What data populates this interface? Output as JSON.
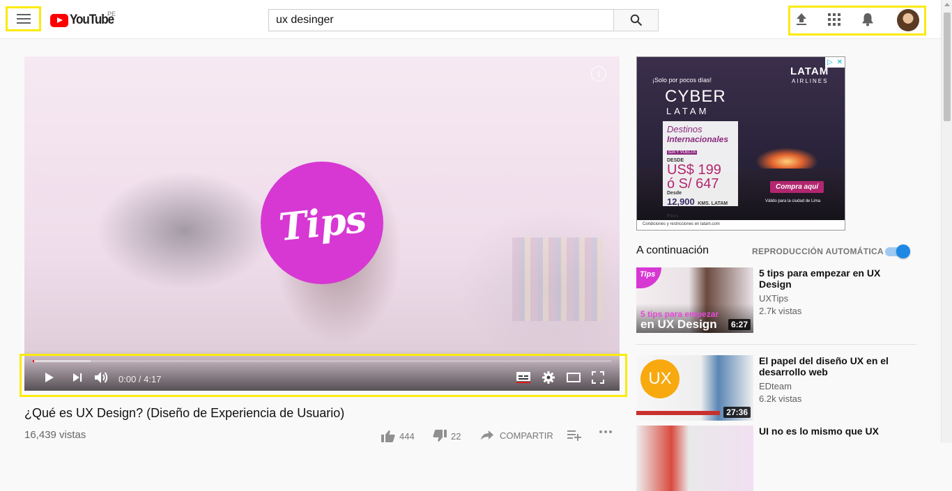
{
  "header": {
    "logo_text": "YouTube",
    "country_code": "PE",
    "search_value": "ux desinger"
  },
  "player": {
    "overlay_text": "Tips",
    "info_glyph": "i",
    "time_current": "0:00",
    "time_separator": " / ",
    "time_total": "4:17",
    "progress_buffered_fraction": 0.1,
    "progress_played_fraction": 0.002
  },
  "ad": {
    "promo_text": "¡Solo por pocos días!",
    "headline": "CYBER",
    "headline_sub": "LATAM",
    "brand": "LATAM",
    "brand_sub": "AIRLINES",
    "card_line1": "Destinos",
    "card_line2": "Internacionales",
    "card_tag": "IDA Y VUELTA",
    "card_from": "DESDE",
    "price_usd": "US$ 199",
    "price_pen": "ó S/ 647",
    "card_from2": "Desde",
    "kms": "12,900",
    "kms_suffix": "KMS. LATAM Pass",
    "cta": "Compra aquí",
    "valid": "Válido para la ciudad de Lima",
    "footer": "Condiciones y restricciones en latam.com"
  },
  "up_next": {
    "title": "A continuación",
    "autoplay_label": "REPRODUCCIÓN AUTOMÁTICA",
    "autoplay_on": true,
    "items": [
      {
        "title": "5 tips para empezar en UX Design",
        "channel": "UXTips",
        "views": "2.7k vistas",
        "duration": "6:27",
        "thumb_badge": "Tips",
        "thumb_line1": "5 tips para empezar",
        "thumb_line2": "en UX Design"
      },
      {
        "title": "El papel del diseño UX en el desarrollo web",
        "channel": "EDteam",
        "views": "6.2k vistas",
        "duration": "27:36",
        "thumb_badge": "UX"
      },
      {
        "title": "UI no es lo mismo que UX"
      }
    ]
  },
  "video": {
    "title": "¿Qué es UX Design? (Diseño de Experiencia de Usuario)",
    "views": "16,439 vistas",
    "likes": "444",
    "dislikes": "22",
    "share_label": "COMPARTIR"
  },
  "colors": {
    "highlight": "#fbea0b",
    "brand_red": "#ff0000",
    "tips_magenta": "#d738d3",
    "toggle_blue": "#1e88e5"
  }
}
